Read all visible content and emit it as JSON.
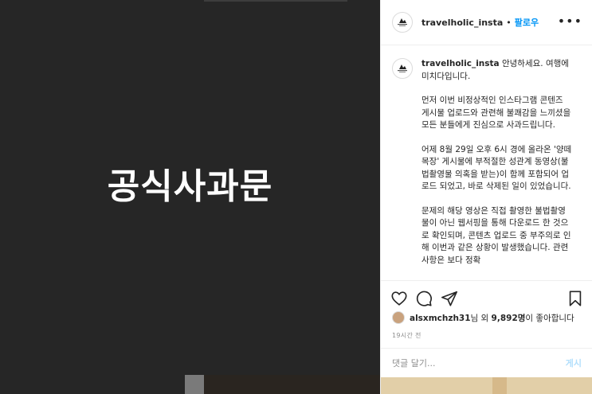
{
  "post": {
    "image_text": "공식사과문"
  },
  "header": {
    "username": "travelholic_insta",
    "separator": "•",
    "follow_label": "팔로우",
    "more_label": "•••"
  },
  "caption": {
    "username": "travelholic_insta",
    "paragraphs": [
      "안녕하세요. 여행에미치다입니다.",
      "먼저 이번 비정상적인 인스타그램 콘텐즈 게시물 업로드와 관련해 불쾌감을 느끼셨을 모든 분들에게 진심으로 사과드립니다.",
      "어제 8월 29일 오후 6시 경에 올라온 '양떼 목장' 게시물에 부적절한 성관계 동영상(불법촬영물 의혹을 받는)이 함께 포함되어 업로드 되었고, 바로 삭제된 일이 있었습니다.",
      "문제의 해당 영상은 직접 촬영한 불법촬영물이 아닌 웹서핑을 통해 다운로드 한 것으로 확인되며, 콘텐츠 업로드 중 부주의로 인해 이번과 같은 상황이 발생했습니다. 관련 사항은 보다 정확"
    ]
  },
  "actions": {
    "like": "heart-icon",
    "comment": "comment-icon",
    "share": "share-icon",
    "save": "bookmark-icon"
  },
  "likes": {
    "user": "alsxmchzh31",
    "rest": "님 외 ",
    "count": "9,892명",
    "suffix": "이 좋아합니다"
  },
  "time_ago": "19시간 전",
  "comment": {
    "placeholder": "댓글 달기...",
    "post_label": "게시"
  },
  "colors": {
    "accent": "#0095f6",
    "post_disabled": "#b2dffc",
    "media_bg": "#262626"
  }
}
